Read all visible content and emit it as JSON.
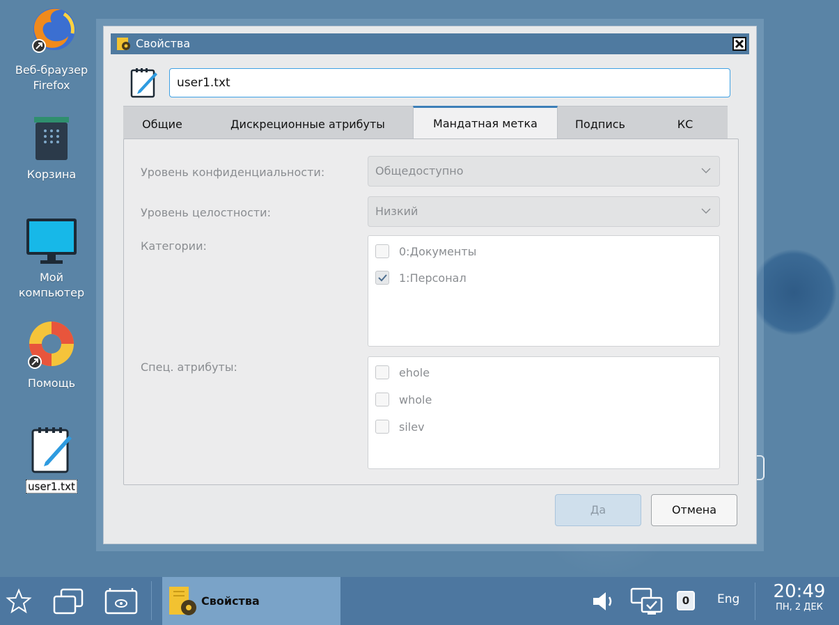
{
  "desktop": {
    "icons": [
      {
        "label": "Веб-браузер Firefox"
      },
      {
        "label": "Корзина"
      },
      {
        "label": "Мой компьютер"
      },
      {
        "label": "Помощь"
      },
      {
        "label": "user1.txt"
      }
    ]
  },
  "dialog": {
    "title": "Свойства",
    "filename": "user1.txt",
    "tabs": [
      {
        "label": "Общие"
      },
      {
        "label": "Дискреционные атрибуты"
      },
      {
        "label": "Мандатная метка",
        "active": true
      },
      {
        "label": "Подпись"
      },
      {
        "label": "КС"
      }
    ],
    "fields": {
      "confidentiality_label": "Уровень конфиденциальности:",
      "confidentiality_value": "Общедоступно",
      "integrity_label": "Уровень целостности:",
      "integrity_value": "Низкий",
      "categories_label": "Категории:",
      "categories": [
        {
          "label": "0:Документы",
          "checked": false
        },
        {
          "label": "1:Персонал",
          "checked": true
        }
      ],
      "special_label": "Спец. атрибуты:",
      "special": [
        {
          "label": "ehole",
          "checked": false
        },
        {
          "label": "whole",
          "checked": false
        },
        {
          "label": "silev",
          "checked": false
        }
      ]
    },
    "buttons": {
      "ok": "Да",
      "cancel": "Отмена"
    }
  },
  "taskbar": {
    "task_label": "Свойства",
    "badge": "0",
    "language": "Eng",
    "time": "20:49",
    "date": "ПН, 2 ДЕК"
  },
  "colors": {
    "desktop": "#5a84a6",
    "titlebar": "#4f7aa0",
    "taskbar": "#4d77a0",
    "accent": "#3c7fb8"
  }
}
